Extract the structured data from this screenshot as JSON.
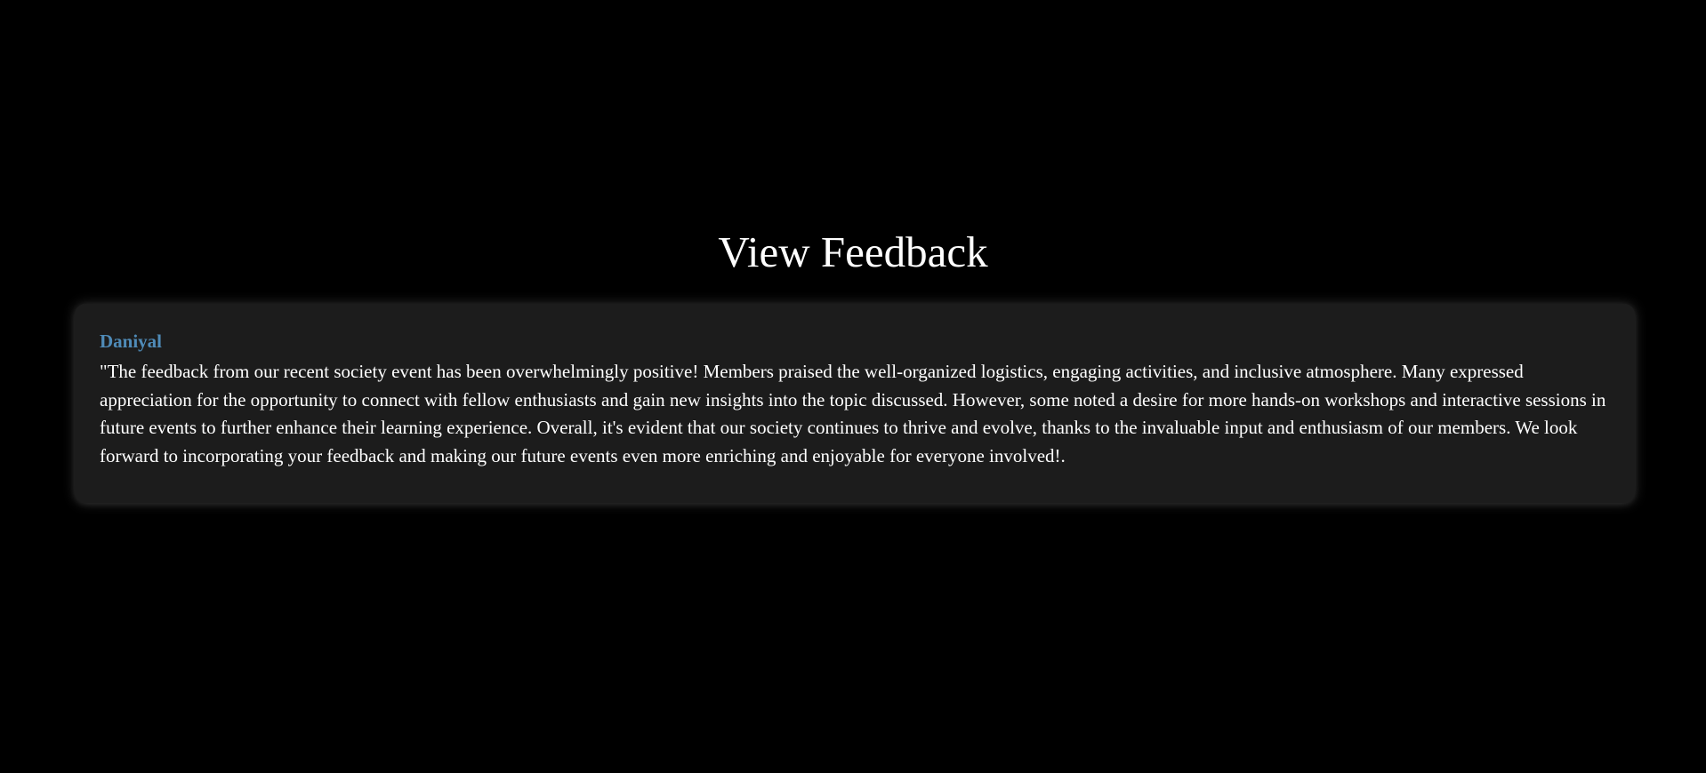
{
  "page": {
    "title": "View Feedback"
  },
  "feedback": [
    {
      "author": "Daniyal",
      "text": "\"The feedback from our recent society event has been overwhelmingly positive! Members praised the well-organized logistics, engaging activities, and inclusive atmosphere. Many expressed appreciation for the opportunity to connect with fellow enthusiasts and gain new insights into the topic discussed. However, some noted a desire for more hands-on workshops and interactive sessions in future events to further enhance their learning experience. Overall, it's evident that our society continues to thrive and evolve, thanks to the invaluable input and enthusiasm of our members. We look forward to incorporating your feedback and making our future events even more enriching and enjoyable for everyone involved!."
    }
  ],
  "colors": {
    "background": "#000000",
    "card_background": "#1c1c1c",
    "author_accent": "#4f8bb8",
    "text": "#ffffff"
  }
}
